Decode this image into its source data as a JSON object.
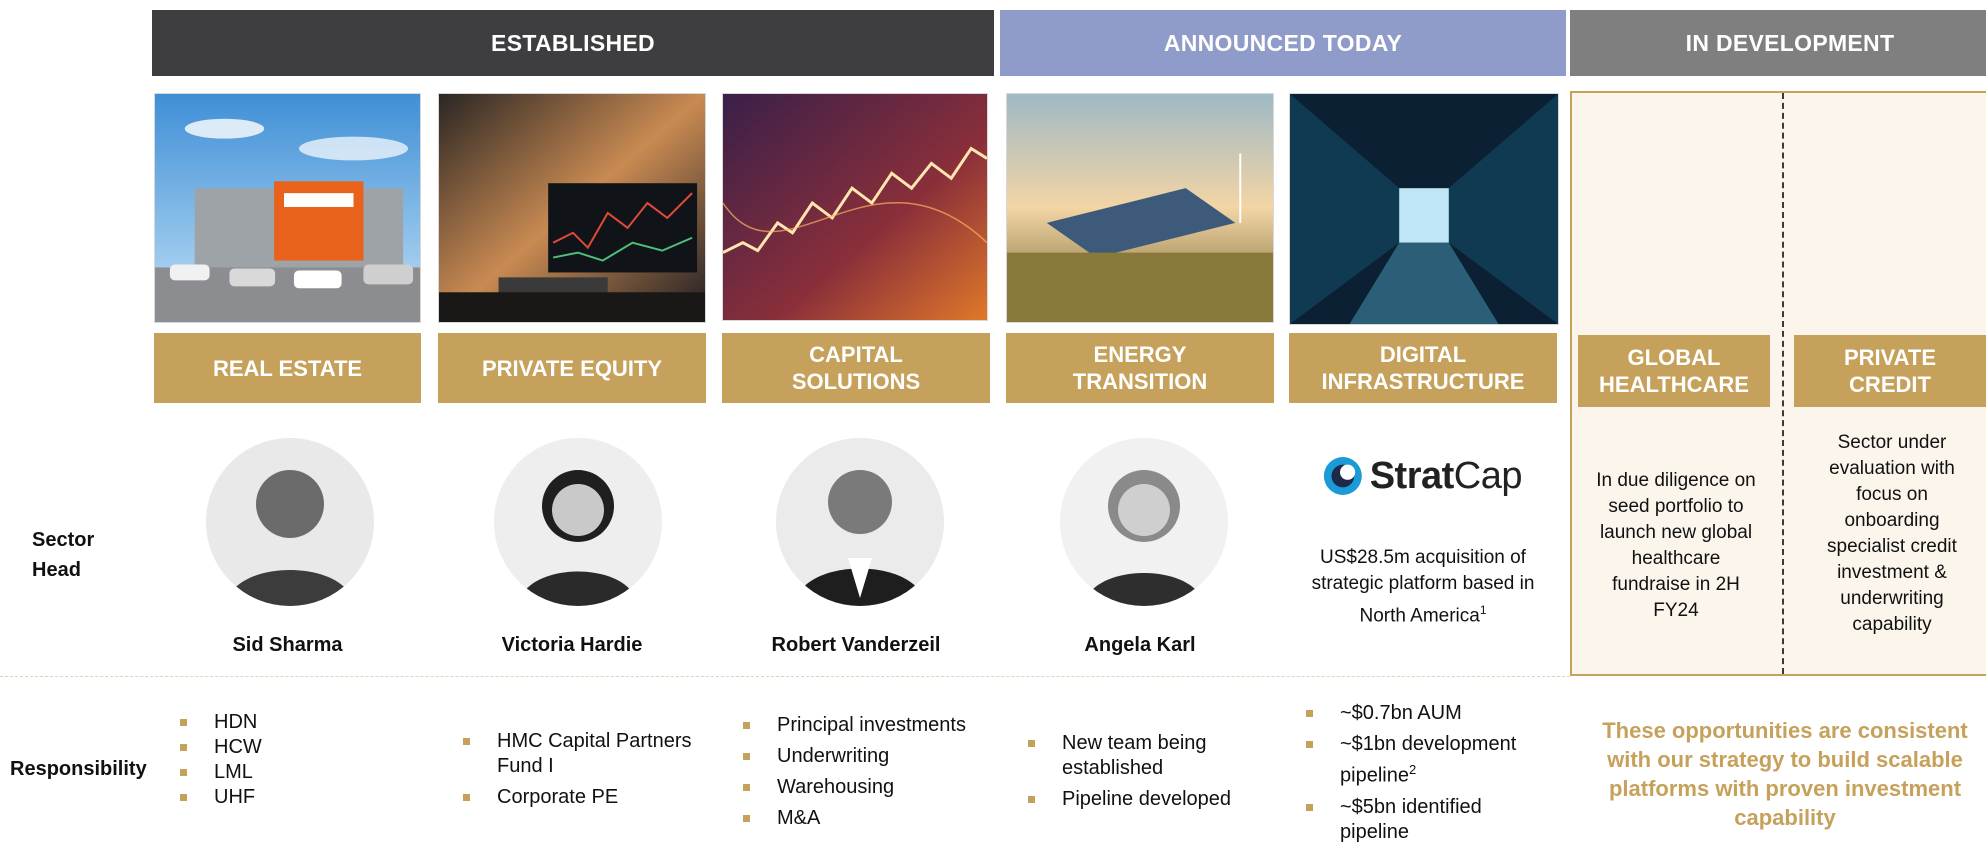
{
  "headers": {
    "established": "ESTABLISHED",
    "announced": "ANNOUNCED TODAY",
    "development": "IN DEVELOPMENT"
  },
  "sectors": [
    {
      "label": "REAL ESTATE",
      "head": "Sid Sharma",
      "responsibilities": [
        "HDN",
        "HCW",
        "LML",
        "UHF"
      ]
    },
    {
      "label": "PRIVATE EQUITY",
      "head": "Victoria Hardie",
      "responsibilities": [
        "HMC Capital Partners Fund I",
        "Corporate PE"
      ]
    },
    {
      "label": "CAPITAL\nSOLUTIONS",
      "head": "Robert Vanderzeil",
      "responsibilities": [
        "Principal investments",
        "Underwriting",
        "Warehousing",
        "M&A"
      ]
    },
    {
      "label": "ENERGY\nTRANSITION",
      "head": "Angela Karl",
      "responsibilities": [
        "New team being established",
        "Pipeline developed"
      ]
    },
    {
      "label": "DIGITAL\nINFRASTRUCTURE",
      "logo_main": "Strat",
      "logo_rest": "Cap",
      "note": "US$28.5m acquisition of strategic platform based in North America",
      "note_sup": "1",
      "responsibilities": [
        "~$0.7bn AUM",
        "~$1bn development pipeline",
        "~$5bn identified pipeline"
      ],
      "responsibility_sup": "2"
    }
  ],
  "development": [
    {
      "label": "GLOBAL\nHEALTHCARE",
      "note": "In due diligence on seed portfolio to launch new global healthcare fundraise in 2H FY24"
    },
    {
      "label": "PRIVATE\nCREDIT",
      "note": "Sector under evaluation with focus on onboarding specialist credit investment & underwriting capability"
    }
  ],
  "row_labels": {
    "sector_head": "Sector\nHead",
    "responsibility": "Responsibility"
  },
  "closing": "These opportunities are consistent with our strategy to build scalable platforms with proven investment capability",
  "colors": {
    "gold": "#c6a15b",
    "dark": "#3e3e40",
    "blue": "#8f9bc9",
    "grey": "#7f7f7f"
  }
}
